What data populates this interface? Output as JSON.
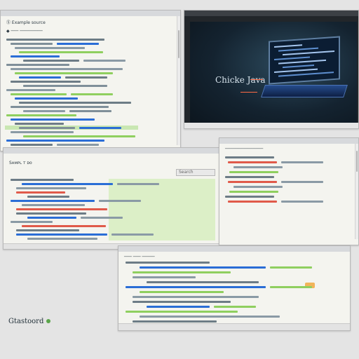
{
  "windows": {
    "editor_top_left": {
      "header": "Ⓢ Example source",
      "title_line": "◆ ─── ─────────"
    },
    "java_preview": {
      "slide_title": "Chicke Java"
    },
    "editor_middle_left": {
      "header": "Sᴀᴍᴘʟ ᴛ ᴅᴏ",
      "filter": "Search"
    },
    "editor_middle_right": {
      "header": "───────────────"
    },
    "editor_bottom": {
      "header": "─── ─── ─────",
      "badge": "──"
    }
  },
  "taskbar": {
    "app_label": "Gtastoord",
    "status_icon": "●"
  },
  "colors": {
    "accent_blue": "#2a6dd6",
    "accent_green": "#8fcf5f",
    "accent_red": "#e05a4a",
    "code_line": "#6d7c86",
    "highlight": "#dcefc7",
    "dark_panel": "#0f1923"
  },
  "icons": [
    "window-close-icon",
    "window-maximize-icon",
    "laptop-icon",
    "arrow-icon",
    "green-dot-icon",
    "orange-badge-icon"
  ]
}
